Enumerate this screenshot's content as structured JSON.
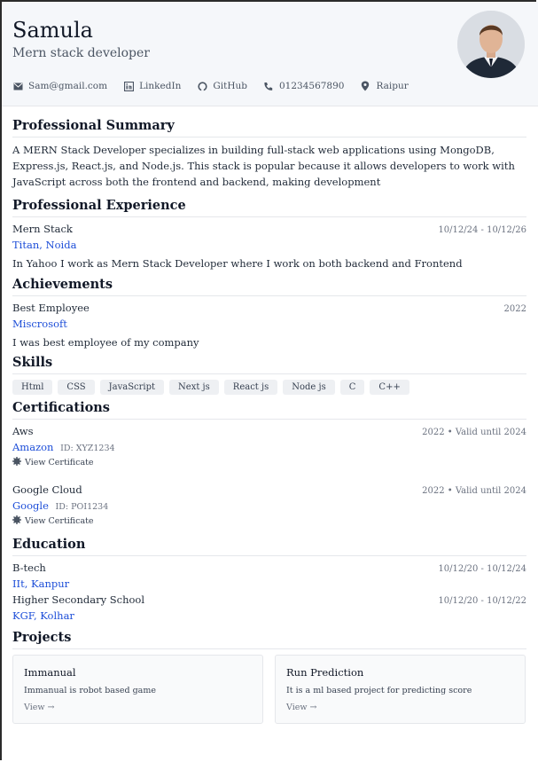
{
  "profile": {
    "name": "Samula",
    "role": "Mern stack developer"
  },
  "contacts": [
    {
      "icon": "email-icon",
      "label": "Sam@gmail.com"
    },
    {
      "icon": "linkedin-icon",
      "label": "LinkedIn"
    },
    {
      "icon": "github-icon",
      "label": "GitHub"
    },
    {
      "icon": "phone-icon",
      "label": "01234567890"
    },
    {
      "icon": "location-icon",
      "label": "Raipur"
    }
  ],
  "summary": {
    "title": "Professional Summary",
    "text": "A MERN Stack Developer specializes in building full-stack web applications using MongoDB, Express.js, React.js, and Node.js. This stack is popular because it allows developers to work with JavaScript across both the frontend and backend, making development"
  },
  "experience": {
    "title": "Professional Experience",
    "items": [
      {
        "role": "Mern Stack",
        "dates": "10/12/24 - 10/12/26",
        "company": "Titan, Noida",
        "desc": "In Yahoo I work as Mern Stack Developer where I work on both backend and Frontend"
      }
    ]
  },
  "achievements": {
    "title": "Achievements",
    "items": [
      {
        "name": "Best Employee",
        "year": "2022",
        "org": "Miscrosoft",
        "desc": "I was best employee of my company"
      }
    ]
  },
  "skills": {
    "title": "Skills",
    "items": [
      "Html",
      "CSS",
      "JavaScript",
      "Next js",
      "React js",
      "Node js",
      "C",
      "C++"
    ]
  },
  "certifications": {
    "title": "Certifications",
    "items": [
      {
        "name": "Aws",
        "validity": "2022 • Valid until 2024",
        "issuer": "Amazon",
        "id": "ID: XYZ1234",
        "link": "View Certificate"
      },
      {
        "name": "Google Cloud",
        "validity": "2022 • Valid until 2024",
        "issuer": "Google",
        "id": "ID: POI1234",
        "link": "View Certificate"
      }
    ]
  },
  "education": {
    "title": "Education",
    "items": [
      {
        "degree": "B-tech",
        "dates": "10/12/20 - 10/12/24",
        "school": "IIt, Kanpur"
      },
      {
        "degree": "Higher Secondary School",
        "dates": "10/12/20 - 10/12/22",
        "school": "KGF, Kolhar"
      }
    ]
  },
  "projects": {
    "title": "Projects",
    "items": [
      {
        "name": "Immanual",
        "desc": "Immanual is robot based game",
        "link": "View →"
      },
      {
        "name": "Run Prediction",
        "desc": "It is a ml based project for predicting score",
        "link": "View →"
      }
    ]
  },
  "colors": {
    "accent_blue": "#1d4ed8",
    "header_bg": "#f5f7fa"
  }
}
